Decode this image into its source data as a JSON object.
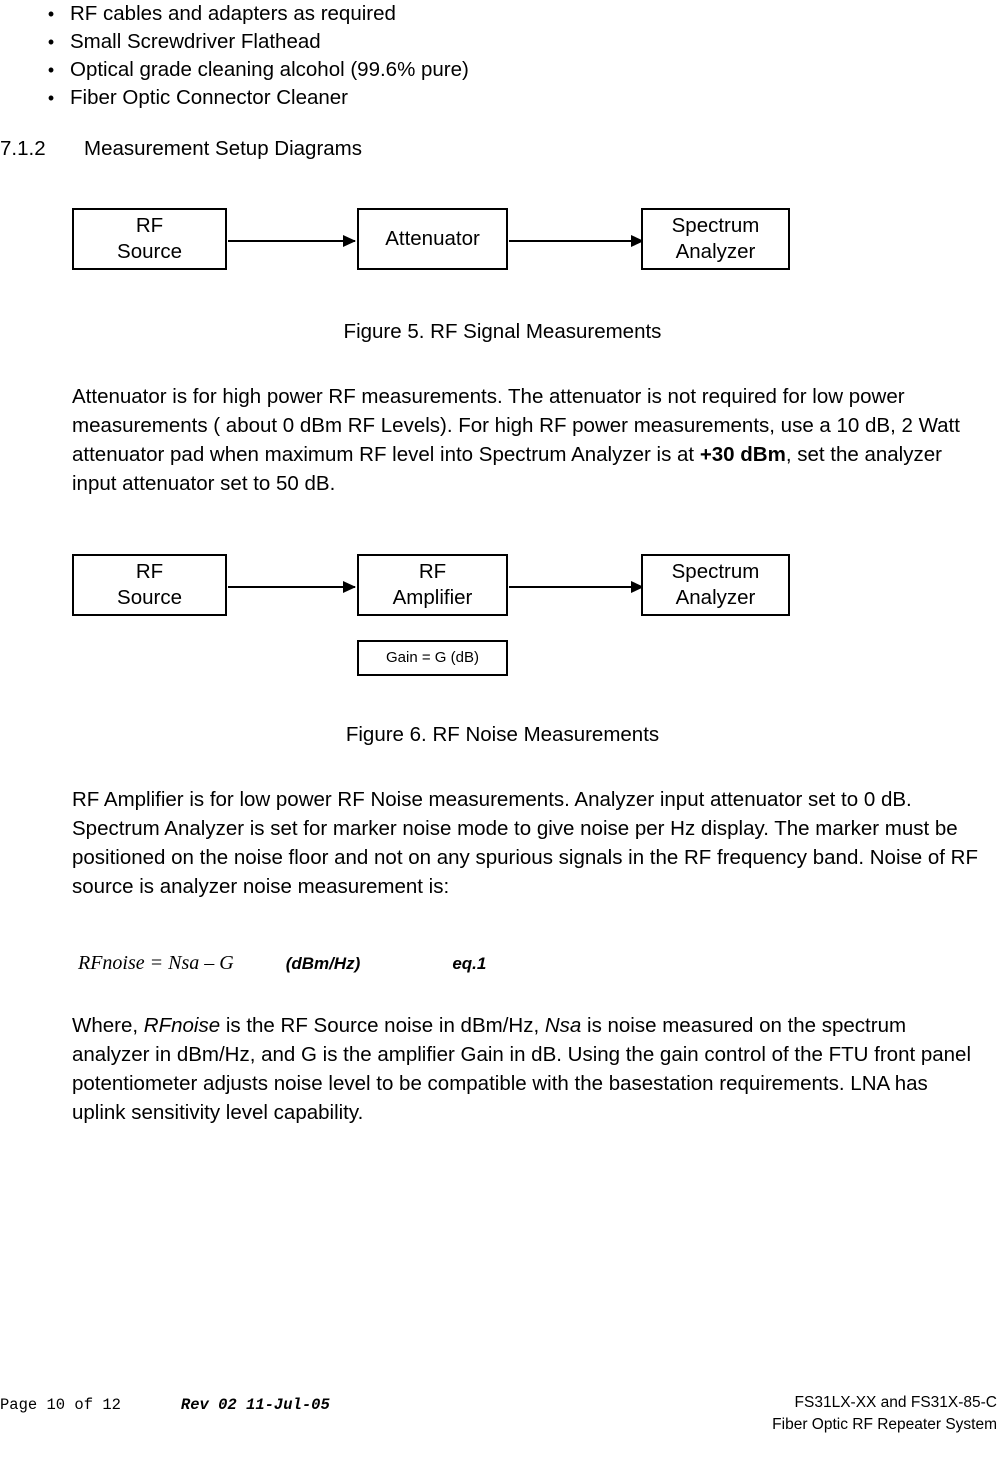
{
  "bullets": [
    "RF cables and adapters as required",
    "Small Screwdriver Flathead",
    "Optical grade cleaning alcohol (99.6% pure)",
    "Fiber Optic Connector Cleaner"
  ],
  "bullet_glyph": "•",
  "heading": {
    "number": "7.1.2",
    "title": "Measurement Setup Diagrams"
  },
  "figure5": {
    "boxes": [
      {
        "line1": "RF",
        "line2": "Source"
      },
      {
        "line1": "Attenuator",
        "line2": ""
      },
      {
        "line1": "Spectrum",
        "line2": "Analyzer"
      }
    ],
    "caption": "Figure 5.  RF Signal Measurements"
  },
  "paragraph1": {
    "part1": "Attenuator is for high power RF measurements.  The attenuator is not required for low power measurements ( about 0 dBm RF Levels).  For high RF power measurements, use a 10 dB, 2 Watt attenuator pad when maximum RF level into Spectrum Analyzer is at ",
    "bold": "+30 dBm",
    "part2": ", set the analyzer input attenuator set to 50 dB."
  },
  "figure6": {
    "boxes": [
      {
        "line1": "RF",
        "line2": "Source"
      },
      {
        "line1": "RF",
        "line2": "Amplifier"
      },
      {
        "line1": "Spectrum",
        "line2": "Analyzer"
      }
    ],
    "gain_box": "Gain = G (dB)",
    "caption": "Figure 6.  RF Noise Measurements"
  },
  "paragraph2": {
    "text": "RF Amplifier is for low power RF Noise measurements.  Analyzer input attenuator set to 0 dB.  Spectrum Analyzer is set for marker noise mode to give noise per Hz display.  The marker must be positioned on the noise floor and not on any spurious signals in the RF frequency band.  Noise of RF source is analyzer noise measurement  is:"
  },
  "equation": {
    "math": "RFnoise = Nsa – G",
    "unit": "(dBm/Hz)",
    "number": "eq.1"
  },
  "paragraph3": {
    "p1": "Where, ",
    "i1": "RFnoise",
    "p2": "  is the RF Source noise in dBm/Hz, ",
    "i2": "Nsa",
    "p3": " is noise measured on the spectrum analyzer in dBm/Hz, and G is the amplifier Gain in dB.  Using the gain control of the FTU front panel potentiometer adjusts noise level to be compatible with the basestation requirements.  LNA has uplink sensitivity level capability."
  },
  "footer": {
    "page": "Page 10 of 12",
    "rev": "Rev 02  11-Jul-05",
    "right_line1": "FS31LX-XX and FS31X-85-C",
    "right_line2": "Fiber Optic RF Repeater System"
  }
}
